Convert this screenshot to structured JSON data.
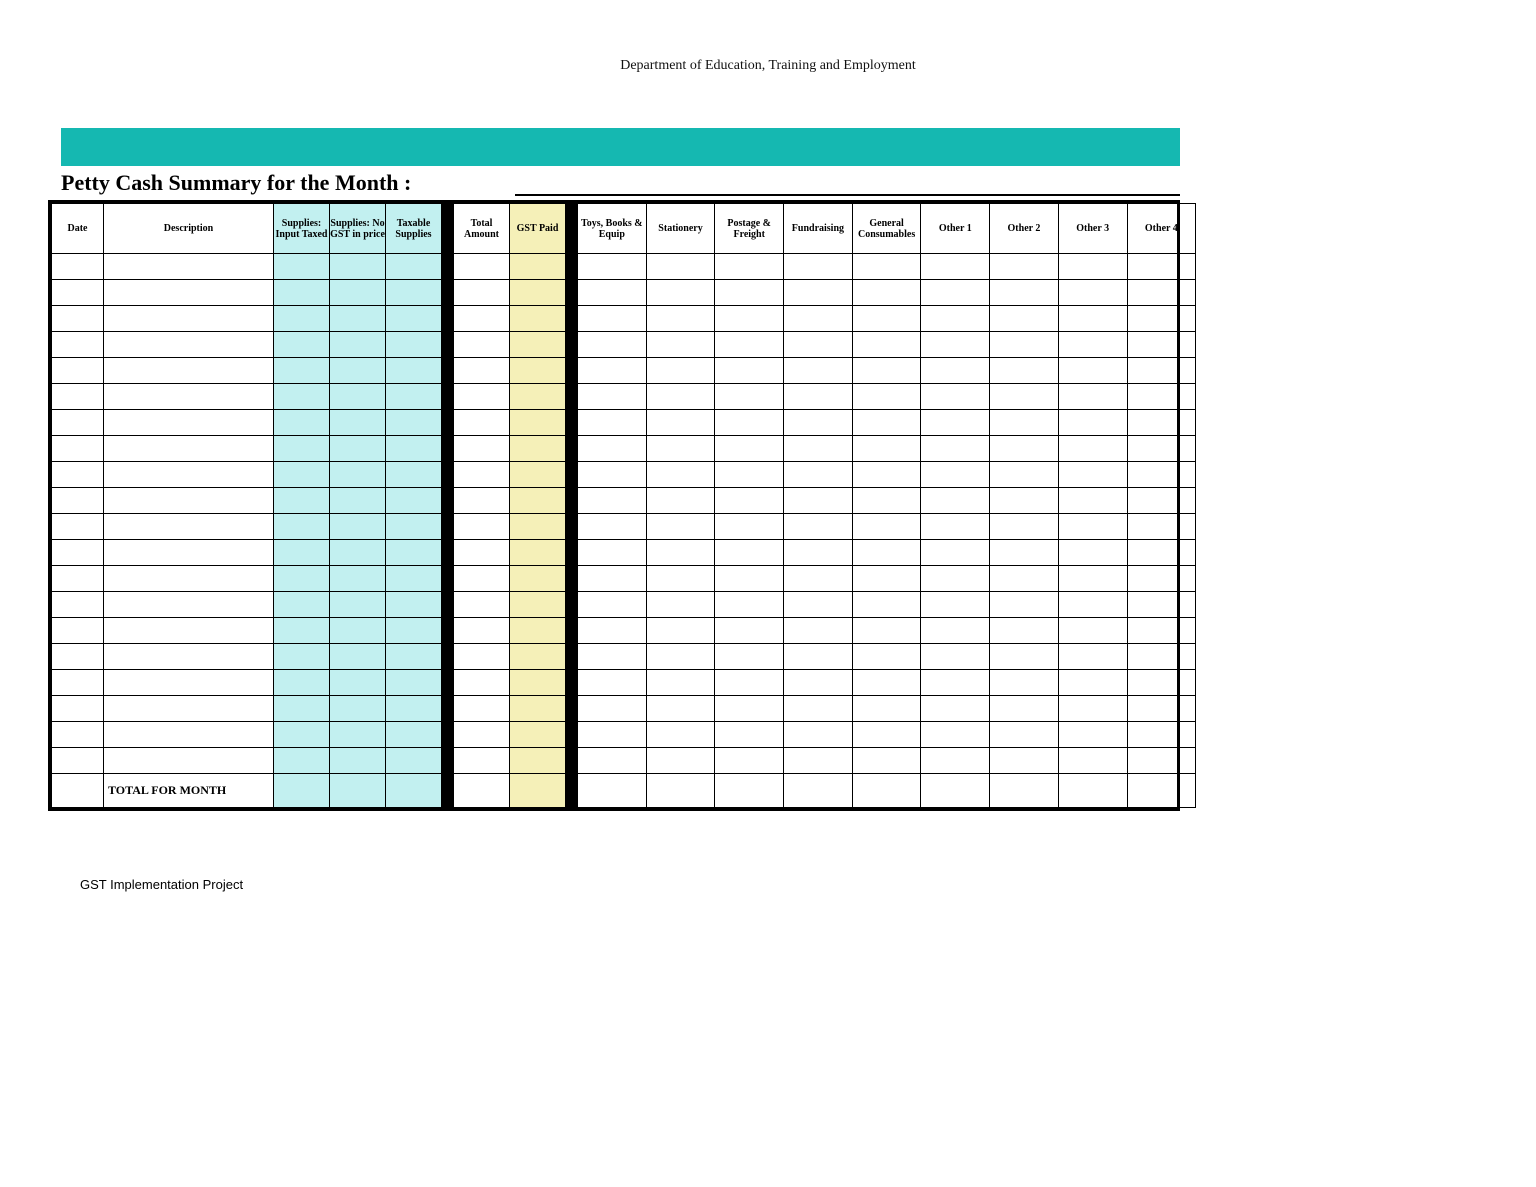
{
  "header": {
    "department": "Department of Education, Training and Employment"
  },
  "title": "Petty Cash Summary for the Month :",
  "columns": {
    "date": "Date",
    "description": "Description",
    "supplies_input_taxed": "Supplies: Input Taxed",
    "supplies_no_gst": "Supplies: No GST in price",
    "taxable_supplies": "Taxable Supplies",
    "total_amount": "Total Amount",
    "gst_paid": "GST Paid",
    "toys_books_equip": "Toys, Books & Equip",
    "stationery": "Stationery",
    "postage_freight": "Postage & Freight",
    "fundraising": "Fundraising",
    "general_consumables": "General Consumables",
    "other1": "Other 1",
    "other2": "Other 2",
    "other3": "Other 3",
    "other4": "Other 4"
  },
  "row_count": 20,
  "total_row_label": "TOTAL FOR MONTH",
  "footer": "GST Implementation Project"
}
